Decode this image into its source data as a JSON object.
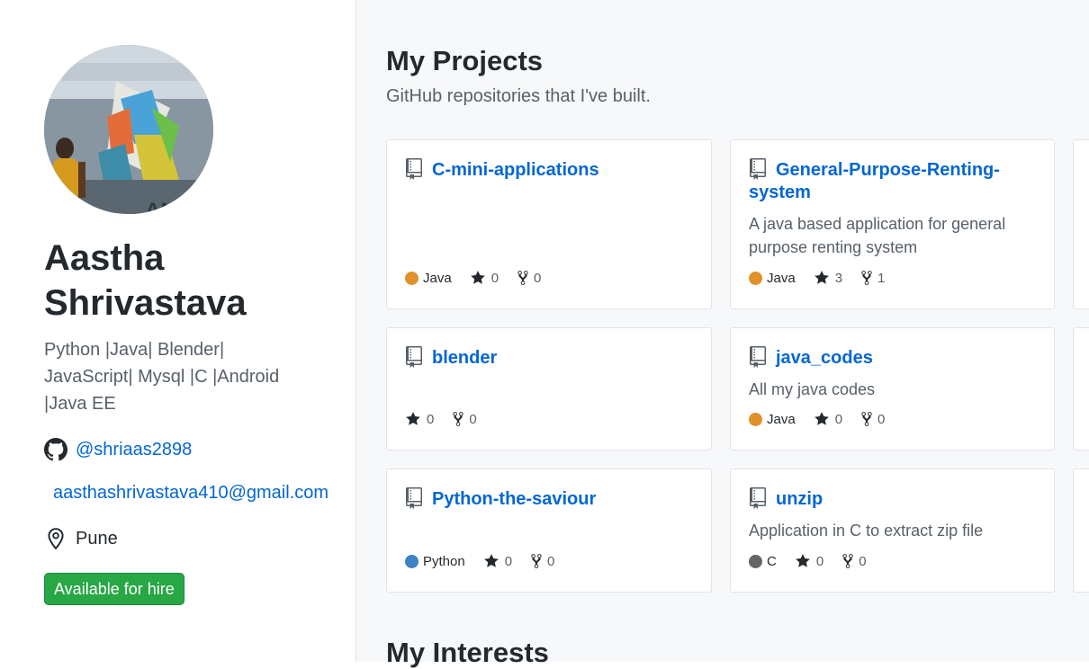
{
  "profile": {
    "name": "Aastha Shrivastava",
    "bio": "Python |Java| Blender| JavaScript| Mysql |C |Android |Java EE",
    "github_handle": "@shriaas2898",
    "email": "aasthashrivastava410@gmail.com",
    "location": "Pune",
    "hire_label": "Available for hire"
  },
  "projects": {
    "heading": "My Projects",
    "subtitle": "GitHub repositories that I've built.",
    "cards": [
      {
        "name": "C-mini-applications",
        "description": "",
        "language": "Java",
        "lang_color": "#e0912a",
        "stars": "0",
        "forks": "0"
      },
      {
        "name": "General-Purpose-Renting-system",
        "description": "A java based application for general purpose renting system",
        "language": "Java",
        "lang_color": "#e0912a",
        "stars": "3",
        "forks": "1"
      },
      {
        "name": "blender",
        "description": "",
        "language": "",
        "lang_color": "",
        "stars": "0",
        "forks": "0"
      },
      {
        "name": "java_codes",
        "description": "All my java codes",
        "language": "Java",
        "lang_color": "#e0912a",
        "stars": "0",
        "forks": "0"
      },
      {
        "name": "Python-the-saviour",
        "description": "",
        "language": "Python",
        "lang_color": "#3b82c6",
        "stars": "0",
        "forks": "0"
      },
      {
        "name": "unzip",
        "description": "Application in C to extract zip file",
        "language": "C",
        "lang_color": "#666666",
        "stars": "0",
        "forks": "0"
      }
    ]
  },
  "interests": {
    "heading": "My Interests"
  },
  "icons": {
    "github": "github-icon",
    "location": "location-pin-icon",
    "repo": "repo-book-icon",
    "star": "star-icon",
    "fork": "fork-icon"
  }
}
